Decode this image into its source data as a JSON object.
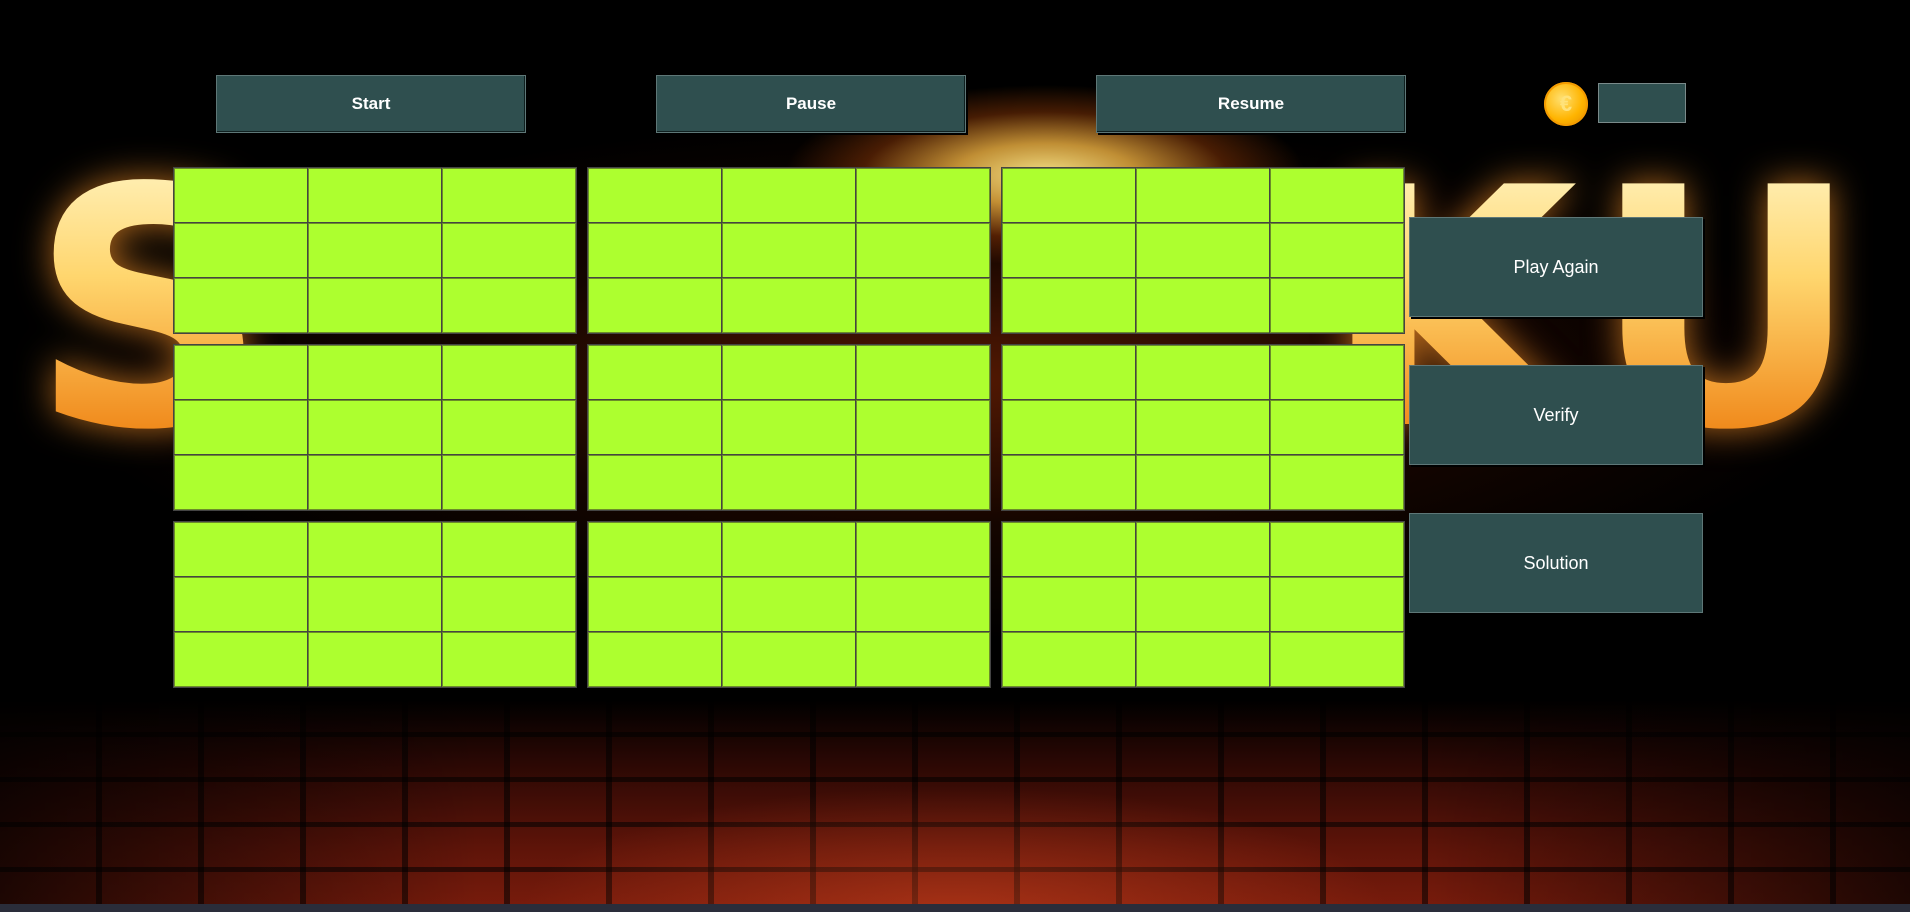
{
  "controls": {
    "start_label": "Start",
    "pause_label": "Pause",
    "resume_label": "Resume"
  },
  "coins": {
    "icon": "coin-icon",
    "value": ""
  },
  "actions": {
    "play_again_label": "Play Again",
    "verify_label": "Verify",
    "solution_label": "Solution"
  },
  "board": {
    "size": 9,
    "box_size": 3,
    "cell_color": "#adff2f",
    "cells": [
      [
        "",
        "",
        "",
        "",
        "",
        "",
        "",
        "",
        ""
      ],
      [
        "",
        "",
        "",
        "",
        "",
        "",
        "",
        "",
        ""
      ],
      [
        "",
        "",
        "",
        "",
        "",
        "",
        "",
        "",
        ""
      ],
      [
        "",
        "",
        "",
        "",
        "",
        "",
        "",
        "",
        ""
      ],
      [
        "",
        "",
        "",
        "",
        "",
        "",
        "",
        "",
        ""
      ],
      [
        "",
        "",
        "",
        "",
        "",
        "",
        "",
        "",
        ""
      ],
      [
        "",
        "",
        "",
        "",
        "",
        "",
        "",
        "",
        ""
      ],
      [
        "",
        "",
        "",
        "",
        "",
        "",
        "",
        "",
        ""
      ],
      [
        "",
        "",
        "",
        "",
        "",
        "",
        "",
        "",
        ""
      ]
    ]
  },
  "theme": {
    "button_color": "#2f4f4f",
    "button_text_color": "#ffffff"
  }
}
